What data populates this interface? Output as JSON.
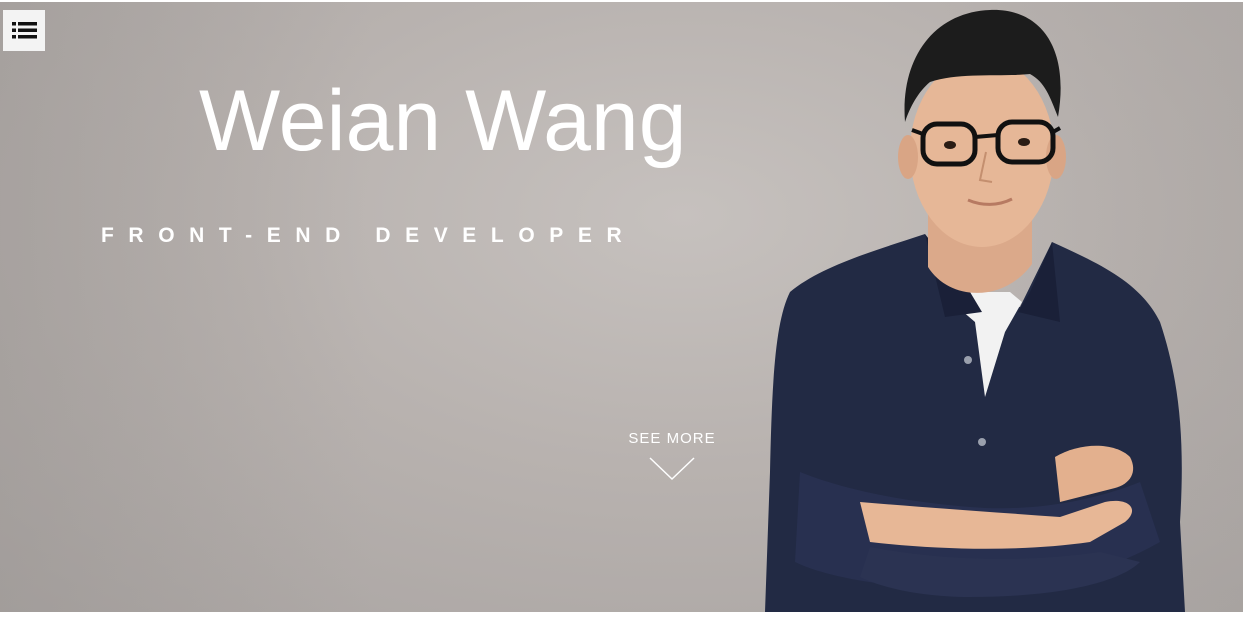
{
  "nav": {
    "menu_icon": "list-icon"
  },
  "hero": {
    "name": "Weian Wang",
    "role": "FRONT-END DEVELOPER",
    "see_more_label": "SEE MORE",
    "arrow_icon": "chevron-down-icon",
    "portrait": "person-portrait"
  },
  "colors": {
    "background": "#b8b2af",
    "text": "#ffffff",
    "menu_bg": "#f3f3f3",
    "shirt": "#222a44"
  }
}
